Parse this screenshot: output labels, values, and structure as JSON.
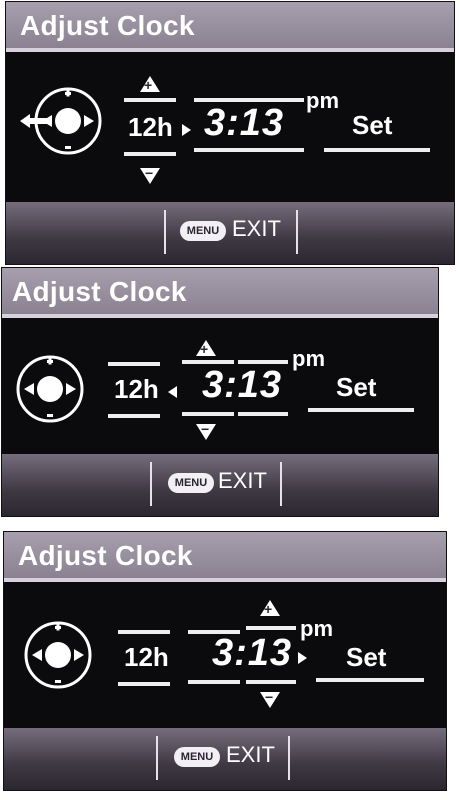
{
  "title": "Adjust Clock",
  "hour_format": "12h",
  "time": "3:13",
  "ampm": "pm",
  "set_label": "Set",
  "menu_label": "MENU",
  "exit_label": "EXIT",
  "plus_glyph": "+",
  "minus_glyph": "−",
  "icons": [
    "dpad-icon",
    "back-arrow-icon",
    "up-arrow-icon",
    "down-arrow-icon",
    "cursor-arrow-icon"
  ]
}
